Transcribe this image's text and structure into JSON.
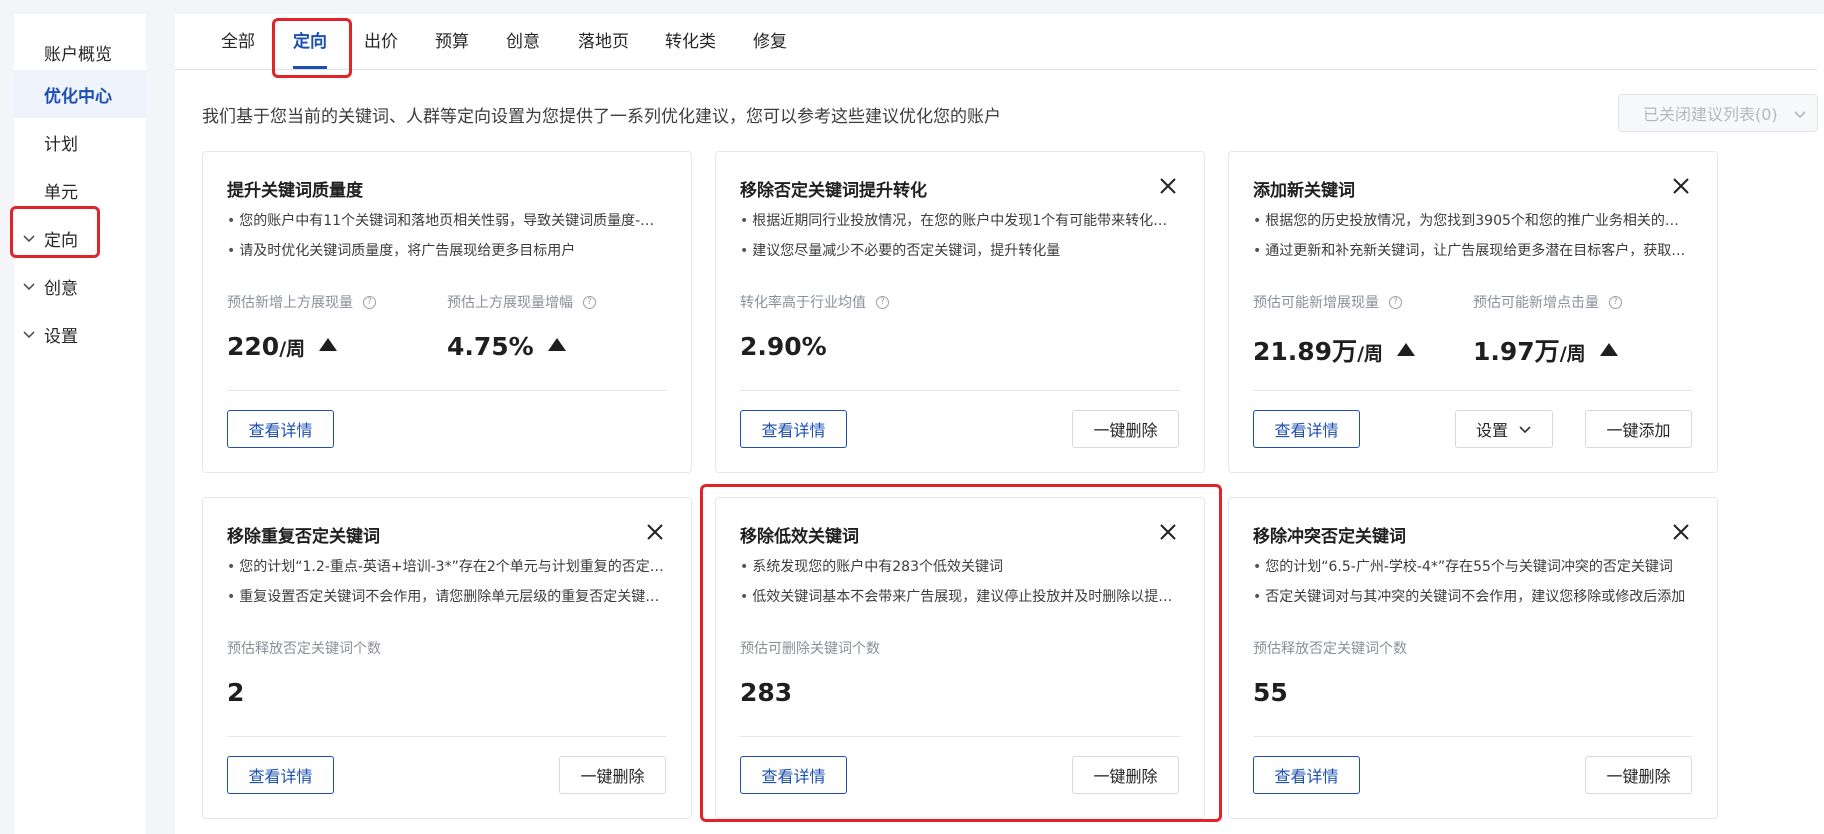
{
  "sidebar": {
    "items": [
      {
        "label": "账户概览"
      },
      {
        "label": "优化中心"
      },
      {
        "label": "计划"
      },
      {
        "label": "单元"
      },
      {
        "label": "定向"
      },
      {
        "label": "创意"
      },
      {
        "label": "设置"
      }
    ]
  },
  "tabs": [
    {
      "label": "全部"
    },
    {
      "label": "定向"
    },
    {
      "label": "出价"
    },
    {
      "label": "预算"
    },
    {
      "label": "创意"
    },
    {
      "label": "落地页"
    },
    {
      "label": "转化类"
    },
    {
      "label": "修复"
    }
  ],
  "description": "我们基于您当前的关键词、人群等定向设置为您提供了一系列优化建议，您可以参考这些建议优化您的账户",
  "closed_list_label": "已关闭建议列表(0)",
  "common": {
    "details_button": "查看详情",
    "delete_button": "一键删除",
    "add_button": "一键添加",
    "settings_button": "设置"
  },
  "cards": [
    {
      "title": "提升关键词质量度",
      "bullets": [
        "您的账户中有11个关键词和落地页相关性弱，导致关键词质量度-…",
        "请及时优化关键词质量度，将广告展现给更多目标用户"
      ],
      "metrics": [
        {
          "label": "预估新增上方展现量",
          "value": "220",
          "unit": "/周"
        },
        {
          "label": "预估上方展现量增幅",
          "value": "4.75%",
          "unit": ""
        }
      ]
    },
    {
      "title": "移除否定关键词提升转化",
      "bullets": [
        "根据近期同行业投放情况，在您的账户中发现1个有可能带来转化…",
        "建议您尽量减少不必要的否定关键词，提升转化量"
      ],
      "metrics": [
        {
          "label": "转化率高于行业均值",
          "value": "2.90%",
          "unit": ""
        }
      ]
    },
    {
      "title": "添加新关键词",
      "bullets": [
        "根据您的历史投放情况，为您找到3905个和您的推广业务相关的…",
        "通过更新和补充新关键词，让广告展现给更多潜在目标客户，获取…"
      ],
      "metrics": [
        {
          "label": "预估可能新增展现量",
          "value": "21.89万",
          "unit": "/周"
        },
        {
          "label": "预估可能新增点击量",
          "value": "1.97万",
          "unit": "/周"
        }
      ]
    },
    {
      "title": "移除重复否定关键词",
      "bullets": [
        "您的计划“1.2-重点-英语+培训-3*”存在2个单元与计划重复的否定…",
        "重复设置否定关键词不会作用，请您删除单元层级的重复否定关键…"
      ],
      "metrics": [
        {
          "label": "预估释放否定关键词个数",
          "value": "2",
          "unit": ""
        }
      ]
    },
    {
      "title": "移除低效关键词",
      "bullets": [
        "系统发现您的账户中有283个低效关键词",
        "低效关键词基本不会带来广告展现，建议停止投放并及时删除以提…"
      ],
      "metrics": [
        {
          "label": "预估可删除关键词个数",
          "value": "283",
          "unit": ""
        }
      ]
    },
    {
      "title": "移除冲突否定关键词",
      "bullets": [
        "您的计划“6.5-广州-学校-4*”存在55个与关键词冲突的否定关键词",
        "否定关键词对与其冲突的关键词不会作用，建议您移除或修改后添加"
      ],
      "metrics": [
        {
          "label": "预估释放否定关键词个数",
          "value": "55",
          "unit": ""
        }
      ]
    }
  ],
  "colors": {
    "accent": "#1d4fb3",
    "annotation_red": "#e0242a",
    "page_background": "#f3f5f8"
  }
}
